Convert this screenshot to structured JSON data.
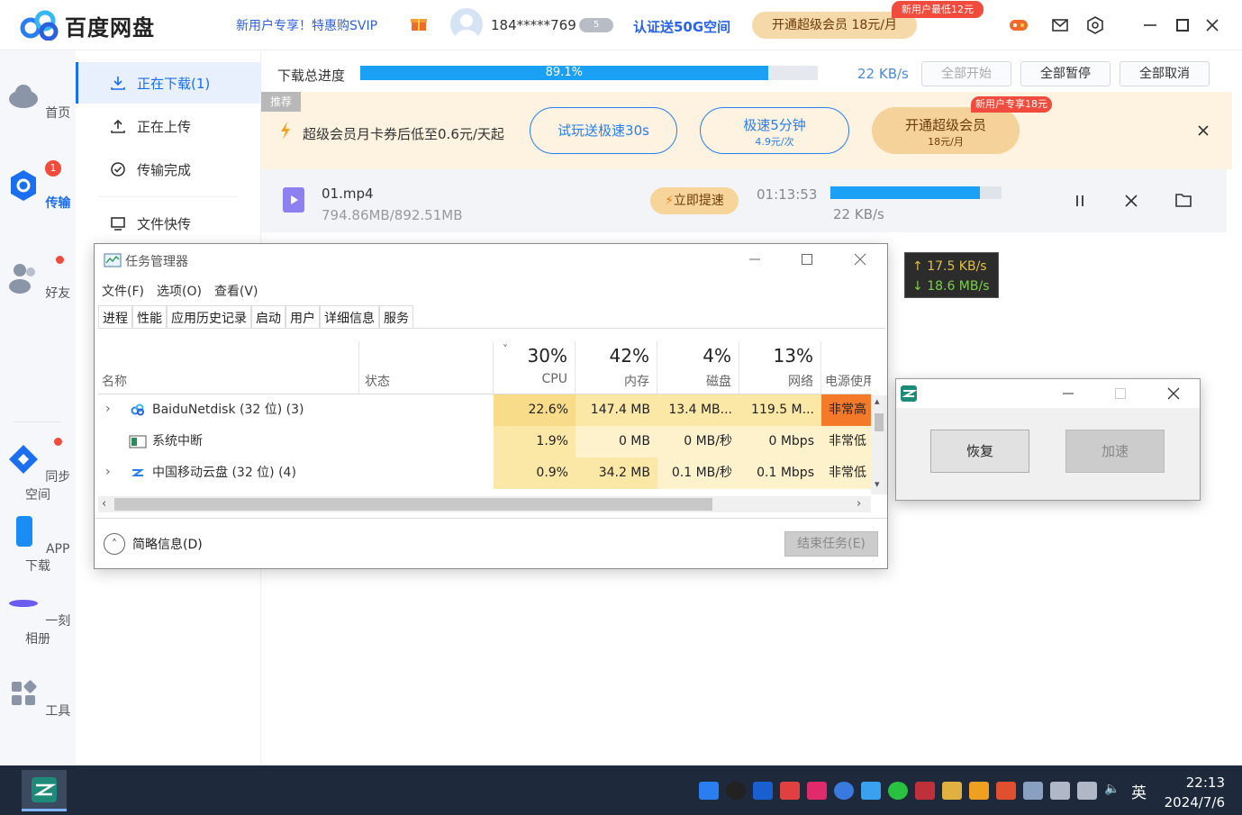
{
  "header": {
    "logo_text": "百度网盘",
    "promo": "新用户专享！特惠购SVIP",
    "user": "184*****769",
    "vip_badge": "5",
    "certify": "认证送50G空间",
    "vip_button": "开通超级会员 18元/月",
    "new_user_tag": "新用户最低12元"
  },
  "sidebar": {
    "items": [
      {
        "label": "首页"
      },
      {
        "label": "传输",
        "badge": "1"
      },
      {
        "label": "好友"
      },
      {
        "label": "同步空间"
      },
      {
        "label": "APP下载"
      },
      {
        "label": "一刻相册"
      },
      {
        "label": "工具"
      }
    ]
  },
  "nav": {
    "items": [
      {
        "label": "正在下载(1)"
      },
      {
        "label": "正在上传"
      },
      {
        "label": "传输完成"
      },
      {
        "label": "文件快传"
      }
    ]
  },
  "download": {
    "label": "下载总进度",
    "progress": 0.891,
    "progress_text": "89.1%",
    "speed": "22 KB/s",
    "start_all": "全部开始",
    "pause_all": "全部暂停",
    "cancel_all": "全部取消"
  },
  "banner": {
    "tag": "推荐",
    "text": "超级会员月卡券后低至0.6元/天起",
    "btn1": "试玩送极速30s",
    "btn2_line1": "极速5分钟",
    "btn2_line2": "4.9元/次",
    "btn3_line1": "开通超级会员",
    "btn3_line2": "18元/月",
    "btn3_tag": "新用户专享18元"
  },
  "task": {
    "name": "01.mp4",
    "size": "794.86MB/892.51MB",
    "boost": "立即提速",
    "time": "01:13:53",
    "progress": 0.874,
    "speed": "22 KB/s"
  },
  "speed_widget": {
    "up": "17.5 KB/s",
    "down": "18.6 MB/s"
  },
  "task_manager": {
    "title": "任务管理器",
    "menu": [
      "文件(F)",
      "选项(O)",
      "查看(V)"
    ],
    "tabs": [
      "进程",
      "性能",
      "应用历史记录",
      "启动",
      "用户",
      "详细信息",
      "服务"
    ],
    "col_name": "名称",
    "col_status": "状态",
    "columns": [
      {
        "pct": "30%",
        "name": "CPU"
      },
      {
        "pct": "42%",
        "name": "内存"
      },
      {
        "pct": "4%",
        "name": "磁盘"
      },
      {
        "pct": "13%",
        "name": "网络"
      },
      {
        "pct": "",
        "name": "电源使用"
      }
    ],
    "rows": [
      {
        "name": "BaiduNetdisk (32 位) (3)",
        "cpu": "22.6%",
        "mem": "147.4 MB",
        "disk": "13.4 MB...",
        "net": "119.5 M...",
        "power": "非常高"
      },
      {
        "name": "系统中断",
        "cpu": "1.9%",
        "mem": "0 MB",
        "disk": "0 MB/秒",
        "net": "0 Mbps",
        "power": "非常低"
      },
      {
        "name": "中国移动云盘 (32 位) (4)",
        "cpu": "0.9%",
        "mem": "34.2 MB",
        "disk": "0.1 MB/秒",
        "net": "0.1 Mbps",
        "power": "非常低"
      }
    ],
    "less_details": "简略信息(D)",
    "end_task": "结束任务(E)"
  },
  "small_window": {
    "restore": "恢复",
    "speedup": "加速"
  },
  "taskbar": {
    "ime": "英",
    "time": "22:13",
    "date": "2024/7/6"
  }
}
